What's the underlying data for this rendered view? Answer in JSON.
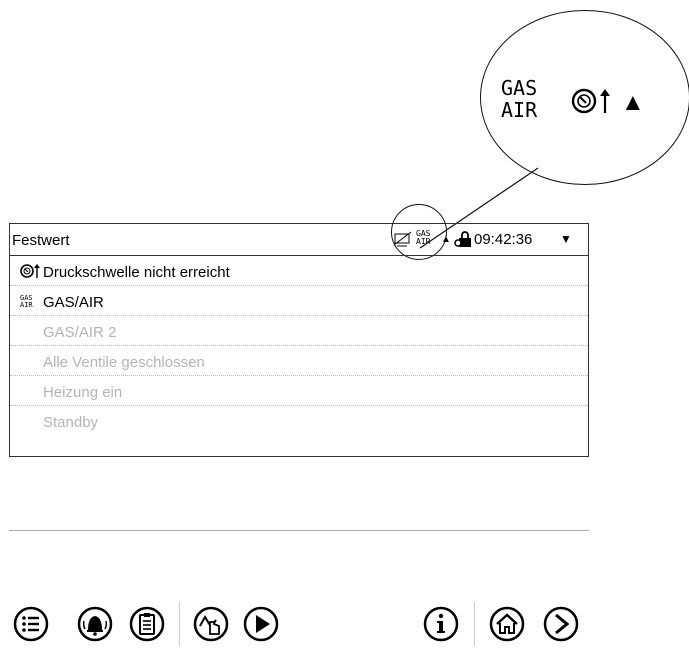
{
  "zoom": {
    "gas_line1": "GAS",
    "gas_line2": "AIR"
  },
  "header": {
    "title": "Festwert",
    "time": "09:42:36",
    "gas_line1": "GAS",
    "gas_line2": "AIR"
  },
  "events": [
    {
      "icon": "pressure-threshold-icon",
      "label": "Druckschwelle nicht erreicht",
      "active": true
    },
    {
      "icon": "gas-air-icon",
      "label": "GAS/AIR",
      "active": true,
      "icon_text1": "GAS",
      "icon_text2": "AIR"
    },
    {
      "icon": "",
      "label": "GAS/AIR 2",
      "active": false
    },
    {
      "icon": "",
      "label": "Alle Ventile geschlossen",
      "active": false
    },
    {
      "icon": "",
      "label": "Heizung ein",
      "active": false
    },
    {
      "icon": "",
      "label": "Standby",
      "active": false
    }
  ],
  "toolbar": [
    "menu-icon",
    "alarm-icon",
    "clipboard-icon",
    "manual-mode-icon",
    "play-icon",
    "info-icon",
    "home-icon",
    "next-icon"
  ]
}
